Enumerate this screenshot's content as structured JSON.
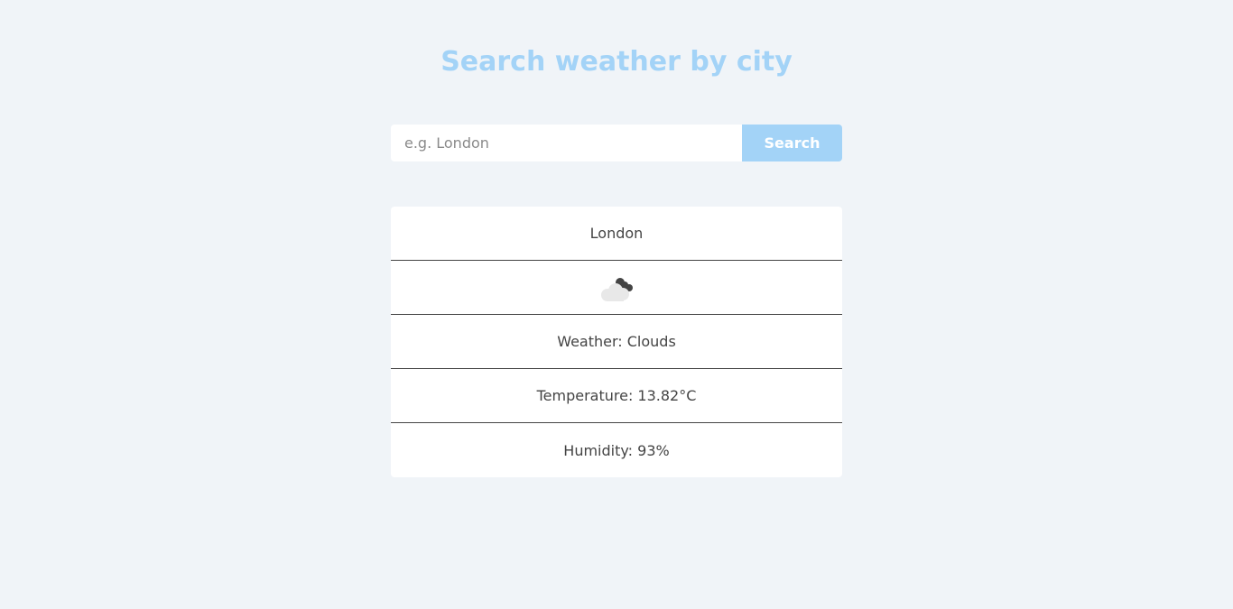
{
  "header": {
    "title": "Search weather by city"
  },
  "search": {
    "placeholder": "e.g. London",
    "value": "",
    "button_label": "Search"
  },
  "weather": {
    "city": "London",
    "icon": "clouds-icon",
    "condition": "Weather: Clouds",
    "temperature": "Temperature: 13.82°C",
    "humidity": "Humidity: 93%"
  },
  "colors": {
    "accent": "#a3d3f7",
    "background": "#f0f4f8",
    "card": "#ffffff",
    "text": "#444444"
  }
}
